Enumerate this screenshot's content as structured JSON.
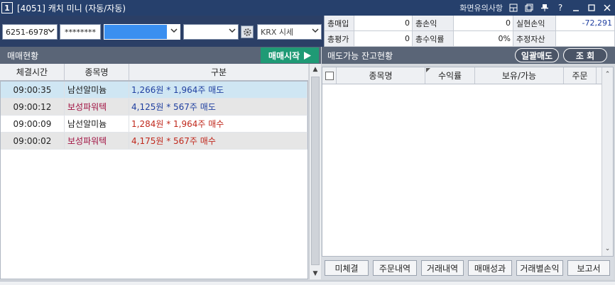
{
  "window": {
    "number": "1",
    "title": "[4051] 캐치 미니 (자동/자동)",
    "notice_link": "화면유의사항"
  },
  "toolbar": {
    "account": "6251-6978",
    "password_mask": "********",
    "strategy_value": "",
    "condition_value": "",
    "market": "KRX 시세"
  },
  "summary": {
    "row1": [
      {
        "label": "총매입",
        "value": "0"
      },
      {
        "label": "총손익",
        "value": "0"
      },
      {
        "label": "실현손익",
        "value": "-72,291"
      }
    ],
    "row2": [
      {
        "label": "총평가",
        "value": "0"
      },
      {
        "label": "총수익률",
        "value": "0%"
      },
      {
        "label": "추정자산",
        "value": ""
      }
    ]
  },
  "left_panel": {
    "title": "매매현황",
    "start_button": "매매시작",
    "columns": [
      "체결시간",
      "종목명",
      "구분"
    ],
    "rows": [
      {
        "time": "09:00:35",
        "name": "남선알미늄",
        "desc": "1,266원 * 1,964주 매도",
        "type": "sell",
        "name_color": "#1a1a1a",
        "bg": "#cfe6f3"
      },
      {
        "time": "09:00:12",
        "name": "보성파워텍",
        "desc": "4,125원 * 567주 매도",
        "type": "sell",
        "name_color": "#a01040",
        "bg": "#e6e6e6"
      },
      {
        "time": "09:00:09",
        "name": "남선알미늄",
        "desc": "1,284원 * 1,964주 매수",
        "type": "buy",
        "name_color": "#1a1a1a",
        "bg": "#ffffff"
      },
      {
        "time": "09:00:02",
        "name": "보성파워텍",
        "desc": "4,175원 * 567주 매수",
        "type": "buy",
        "name_color": "#a01040",
        "bg": "#e6e6e6"
      }
    ]
  },
  "right_panel": {
    "title": "매도가능 잔고현황",
    "sell_all_button": "일괄매도",
    "query_button": "조 회",
    "columns": [
      "종목명",
      "수익률",
      "보유/가능",
      "주문"
    ]
  },
  "bottom_buttons": [
    "미체결",
    "주문내역",
    "거래내역",
    "매매성과",
    "거래별손익",
    "보고서"
  ],
  "colors": {
    "titlebar": "#26406c",
    "panel_header": "#5a6577",
    "start_button": "#1f9a75",
    "sell_text": "#1f3fa0",
    "buy_text": "#c0281c",
    "negative": "#1f3fa0"
  }
}
